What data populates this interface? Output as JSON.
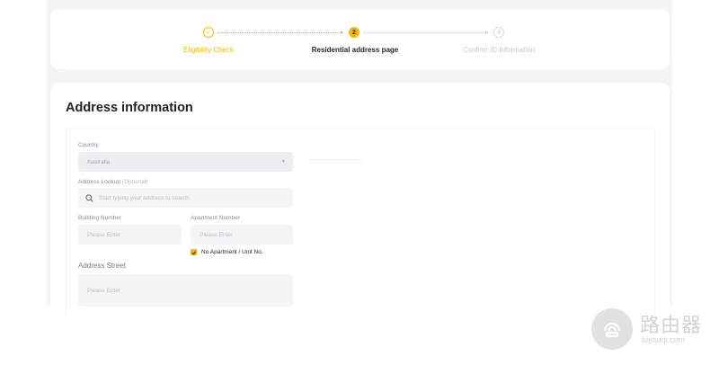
{
  "stepper": {
    "steps": [
      {
        "label": "Eligibility Check",
        "marker": "✓",
        "state": "completed"
      },
      {
        "label": "Residential address page",
        "marker": "2",
        "state": "current"
      },
      {
        "label": "Confirm ID Information",
        "marker": "3",
        "state": "upcoming"
      }
    ]
  },
  "form": {
    "title": "Address information",
    "country": {
      "label": "Country",
      "value": "Australia"
    },
    "lookup": {
      "label": "Address Lookup",
      "optional": "(Optional)",
      "placeholder": "Start typing your address to search"
    },
    "building": {
      "label": "Building Number",
      "placeholder": "Please Enter"
    },
    "apartment": {
      "label": "Apartment Number",
      "placeholder": "Please Enter"
    },
    "no_apartment": {
      "label": "No Apartment / Unit No.",
      "checked": true
    },
    "street": {
      "label": "Address Street",
      "placeholder": "Please Enter"
    }
  },
  "watermark": {
    "title": "路由器",
    "subtitle": "luyouqi.com"
  },
  "colors": {
    "accent": "#f0b90b",
    "text": "#1e2329",
    "muted": "#848e9c",
    "field_bg": "#f5f5f5"
  }
}
